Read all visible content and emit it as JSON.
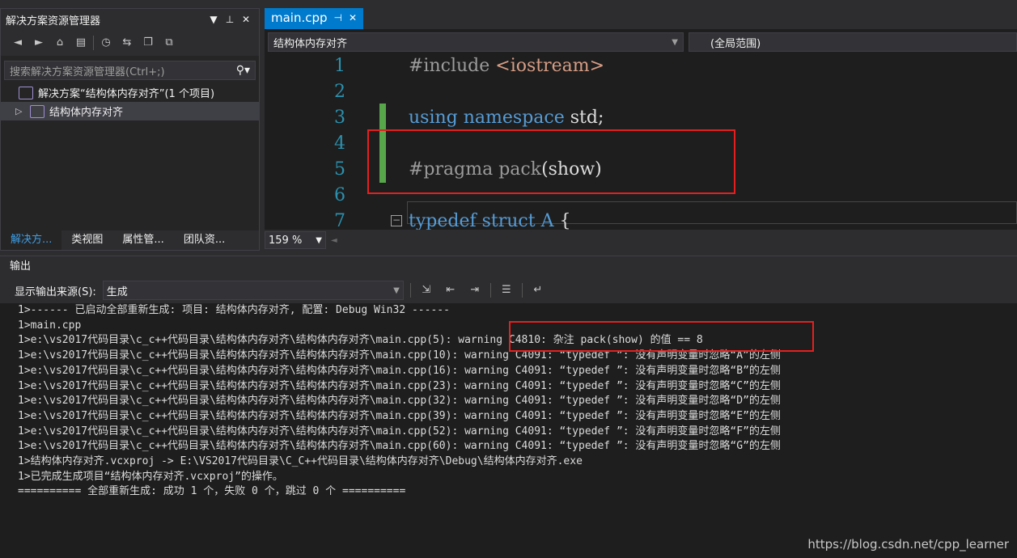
{
  "solution_explorer": {
    "title": "解决方案资源管理器",
    "dropdown_glyph": "▼",
    "pin_glyph": "⊥",
    "close_glyph": "✕",
    "search_placeholder": "搜索解决方案资源管理器(Ctrl+;)",
    "tree": [
      {
        "label": "解决方案“结构体内存对齐”(1 个项目)"
      },
      {
        "label": "结构体内存对齐"
      }
    ],
    "bottom_tabs": [
      "解决方...",
      "类视图",
      "属性管...",
      "团队资..."
    ]
  },
  "editor": {
    "tab_label": "main.cpp",
    "nav_left": "结构体内存对齐",
    "nav_right": "(全局范围)",
    "lines": [
      {
        "n": "1",
        "parts": [
          [
            "pp",
            "#include "
          ],
          [
            "inc",
            "<iostream>"
          ]
        ]
      },
      {
        "n": "2",
        "parts": []
      },
      {
        "n": "3",
        "parts": [
          [
            "kw",
            "using namespace"
          ],
          [
            "txt",
            " std;"
          ]
        ]
      },
      {
        "n": "4",
        "parts": []
      },
      {
        "n": "5",
        "parts": [
          [
            "pp",
            "#pragma pack"
          ],
          [
            "txt",
            "(show)"
          ]
        ]
      },
      {
        "n": "6",
        "parts": []
      },
      {
        "n": "7",
        "parts": [
          [
            "kw",
            "typedef struct"
          ],
          [
            "txt",
            " "
          ],
          [
            "kw",
            "A"
          ],
          [
            "txt",
            " {"
          ]
        ]
      }
    ],
    "zoom": "159 %"
  },
  "output": {
    "title": "输出",
    "source_label": "显示输出来源(S):",
    "source_value": "生成",
    "lines": [
      "1>------ 已启动全部重新生成: 项目: 结构体内存对齐, 配置: Debug Win32 ------",
      "1>main.cpp",
      "1>e:\\vs2017代码目录\\c_c++代码目录\\结构体内存对齐\\结构体内存对齐\\main.cpp(5): warning C4810: 杂注 pack(show) 的值 == 8",
      "1>e:\\vs2017代码目录\\c_c++代码目录\\结构体内存对齐\\结构体内存对齐\\main.cpp(10): warning C4091: “typedef ”: 没有声明变量时忽略“A”的左侧",
      "1>e:\\vs2017代码目录\\c_c++代码目录\\结构体内存对齐\\结构体内存对齐\\main.cpp(16): warning C4091: “typedef ”: 没有声明变量时忽略“B”的左侧",
      "1>e:\\vs2017代码目录\\c_c++代码目录\\结构体内存对齐\\结构体内存对齐\\main.cpp(23): warning C4091: “typedef ”: 没有声明变量时忽略“C”的左侧",
      "1>e:\\vs2017代码目录\\c_c++代码目录\\结构体内存对齐\\结构体内存对齐\\main.cpp(32): warning C4091: “typedef ”: 没有声明变量时忽略“D”的左侧",
      "1>e:\\vs2017代码目录\\c_c++代码目录\\结构体内存对齐\\结构体内存对齐\\main.cpp(39): warning C4091: “typedef ”: 没有声明变量时忽略“E”的左侧",
      "1>e:\\vs2017代码目录\\c_c++代码目录\\结构体内存对齐\\结构体内存对齐\\main.cpp(52): warning C4091: “typedef ”: 没有声明变量时忽略“F”的左侧",
      "1>e:\\vs2017代码目录\\c_c++代码目录\\结构体内存对齐\\结构体内存对齐\\main.cpp(60): warning C4091: “typedef ”: 没有声明变量时忽略“G”的左侧",
      "1>结构体内存对齐.vcxproj -> E:\\VS2017代码目录\\C_C++代码目录\\结构体内存对齐\\Debug\\结构体内存对齐.exe",
      "1>已完成生成项目“结构体内存对齐.vcxproj”的操作。",
      "========== 全部重新生成: 成功 1 个，失败 0 个，跳过 0 个 =========="
    ]
  },
  "watermark": "https://blog.csdn.net/cpp_learner"
}
